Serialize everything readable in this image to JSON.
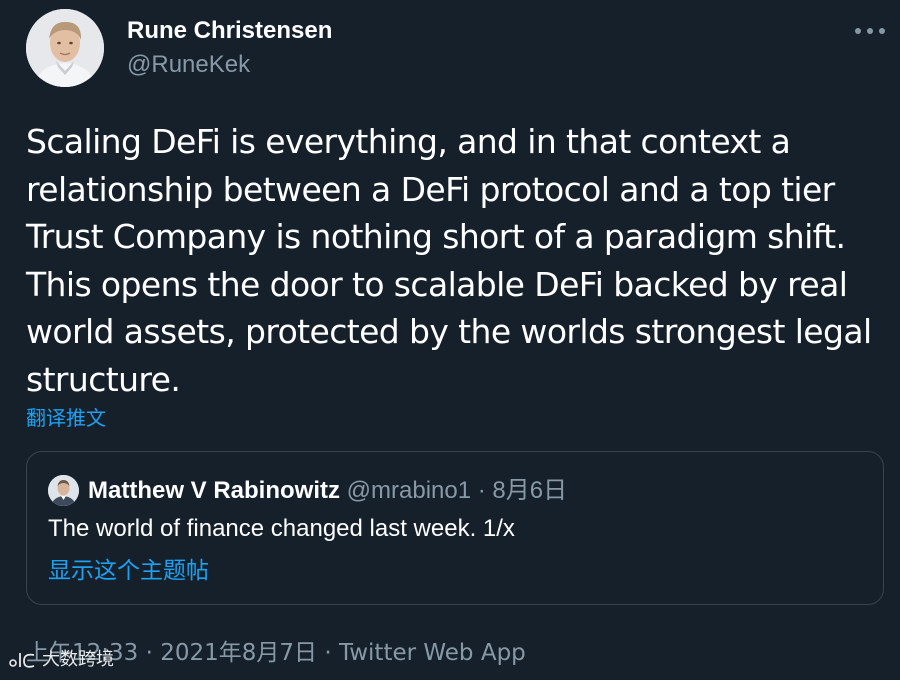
{
  "author": {
    "display_name": "Rune Christensen",
    "handle": "@RuneKek",
    "avatar_icon": "profile-photo"
  },
  "more_icon": "more-dots-icon",
  "tweet": {
    "text": "Scaling DeFi is everything, and in that context a relationship between a DeFi protocol and a top tier Trust Company is nothing short of a paradigm shift. This opens the door to scalable DeFi backed by real world assets, protected by the worlds strongest legal structure.",
    "translate_label": "翻译推文"
  },
  "quoted_tweet": {
    "display_name": "Matthew V Rabinowitz",
    "handle": "@mrabino1",
    "separator": " · ",
    "date": "8月6日",
    "text": "The world of finance changed last week. 1/x",
    "show_thread_label": "显示这个主题帖"
  },
  "meta": {
    "time": "上午12:33",
    "separator": " · ",
    "date": "2021年8月7日",
    "source": "Twitter Web App"
  },
  "watermark": {
    "text": "大数跨境"
  },
  "colors": {
    "background": "#15202b",
    "text_primary": "#ffffff",
    "text_secondary": "#8899a6",
    "link": "#1da1f2",
    "border": "#38444d"
  }
}
